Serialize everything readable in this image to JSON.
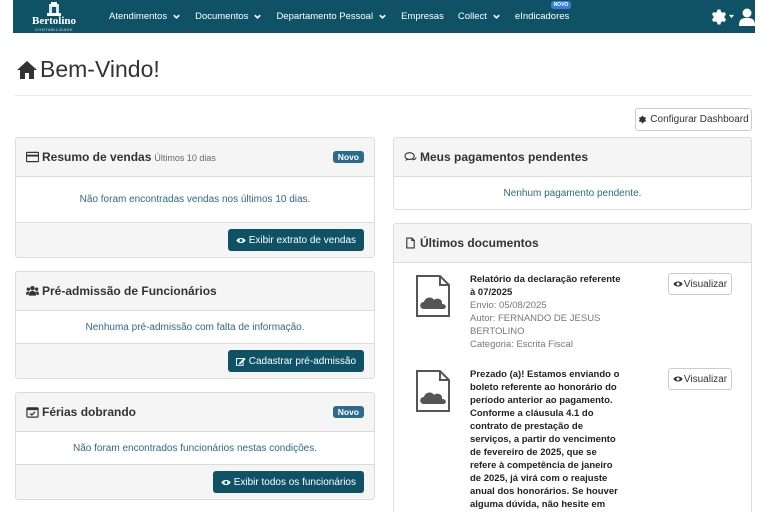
{
  "navbar": {
    "logo_name": "Bertolino",
    "logo_sub": "CONTABILIDADE",
    "items": [
      {
        "label": "Atendimentos",
        "caret": true
      },
      {
        "label": "Documentos",
        "caret": true
      },
      {
        "label": "Departamento Pessoal",
        "caret": true
      },
      {
        "label": "Empresas",
        "caret": false
      },
      {
        "label": "Collect",
        "caret": true
      },
      {
        "label": "eIndicadores",
        "caret": false,
        "badge": "NOVO"
      }
    ]
  },
  "page": {
    "title": "Bem-Vindo!",
    "config_button": "Configurar Dashboard"
  },
  "sales": {
    "title": "Resumo de vendas",
    "subtitle": "Últimos 10 dias",
    "badge": "Novo",
    "message": "Não foram encontradas vendas nos últimos 10 dias.",
    "button": "Exibir extrato de vendas"
  },
  "preadmission": {
    "title": "Pré-admissão de Funcionários",
    "message": "Nenhuma pré-admissão com falta de informação.",
    "button": "Cadastrar pré-admissão"
  },
  "vacation": {
    "title": "Férias dobrando",
    "badge": "Novo",
    "message": "Não foram encontrados funcionários nestas condições.",
    "button": "Exibir todos os funcionários"
  },
  "payments": {
    "title": "Meus pagamentos pendentes",
    "message": "Nenhum pagamento pendente."
  },
  "documents": {
    "title": "Últimos documentos",
    "view_label": "Visualizar",
    "items": [
      {
        "title": "Relatório da declaração referente à 07/2025",
        "sent": "Envio: 05/08/2025",
        "author": "Autor: FERNANDO DE JESUS BERTOLINO",
        "category": "Categoria: Escrita Fiscal"
      },
      {
        "title": "Prezado (a)! Estamos enviando o boleto referente ao honorário do período anterior ao pagamento. Conforme a cláusula 4.1 do contrato de prestação de serviços, a partir do vencimento de fevereiro de 2025, que se refere à competência de janeiro de 2025, já virá com o reajuste anual dos honorários. Se houver alguma dúvida, não hesite em nos"
      }
    ]
  }
}
